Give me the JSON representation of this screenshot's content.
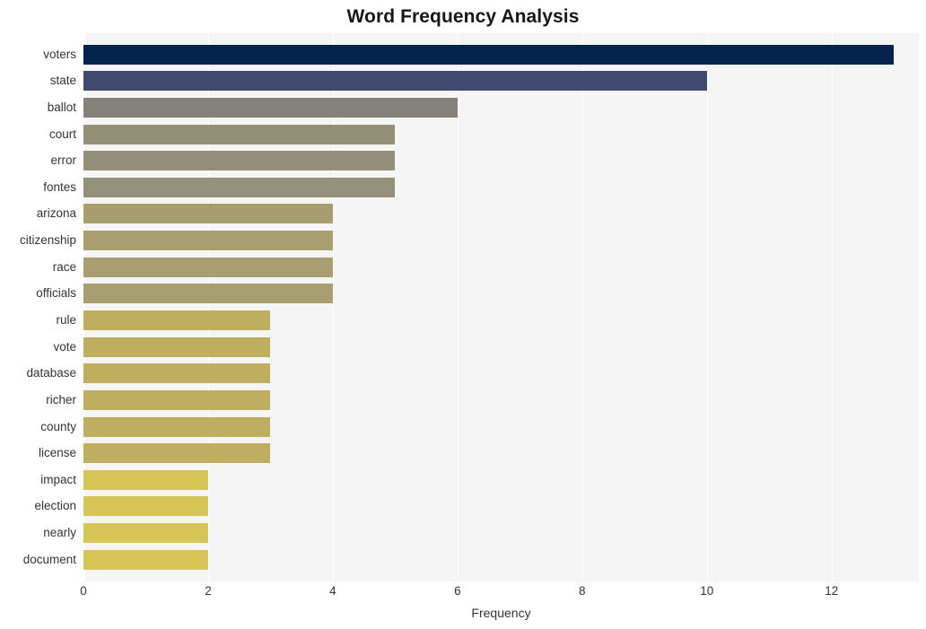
{
  "chart_data": {
    "type": "bar",
    "orientation": "horizontal",
    "title": "Word Frequency Analysis",
    "xlabel": "Frequency",
    "ylabel": "",
    "xlim": [
      0,
      13.4
    ],
    "ylim": null,
    "grid": true,
    "legend": null,
    "xticks": [
      0,
      2,
      4,
      6,
      8,
      10,
      12
    ],
    "xtick_labels": [
      "0",
      "2",
      "4",
      "6",
      "8",
      "10",
      "12"
    ],
    "categories": [
      "voters",
      "state",
      "ballot",
      "court",
      "error",
      "fontes",
      "arizona",
      "citizenship",
      "race",
      "officials",
      "rule",
      "vote",
      "database",
      "richer",
      "county",
      "license",
      "impact",
      "election",
      "nearly",
      "document"
    ],
    "values": [
      13,
      10,
      6,
      5,
      5,
      5,
      4,
      4,
      4,
      4,
      3,
      3,
      3,
      3,
      3,
      3,
      2,
      2,
      2,
      2
    ],
    "bar_colors": [
      "#04244f",
      "#414a6f",
      "#83817a",
      "#948f77",
      "#948f79",
      "#95907a",
      "#a89d6f",
      "#a99e70",
      "#a99e71",
      "#a99e72",
      "#bfae5e",
      "#bfae5e",
      "#bfae5e",
      "#bfae5f",
      "#bfae5f",
      "#bfae5f",
      "#d6c457",
      "#d6c457",
      "#d6c457",
      "#d6c457"
    ],
    "plot_background": "#f5f5f5",
    "grid_color": "#ffffff",
    "figure_background": "#ffffff"
  }
}
